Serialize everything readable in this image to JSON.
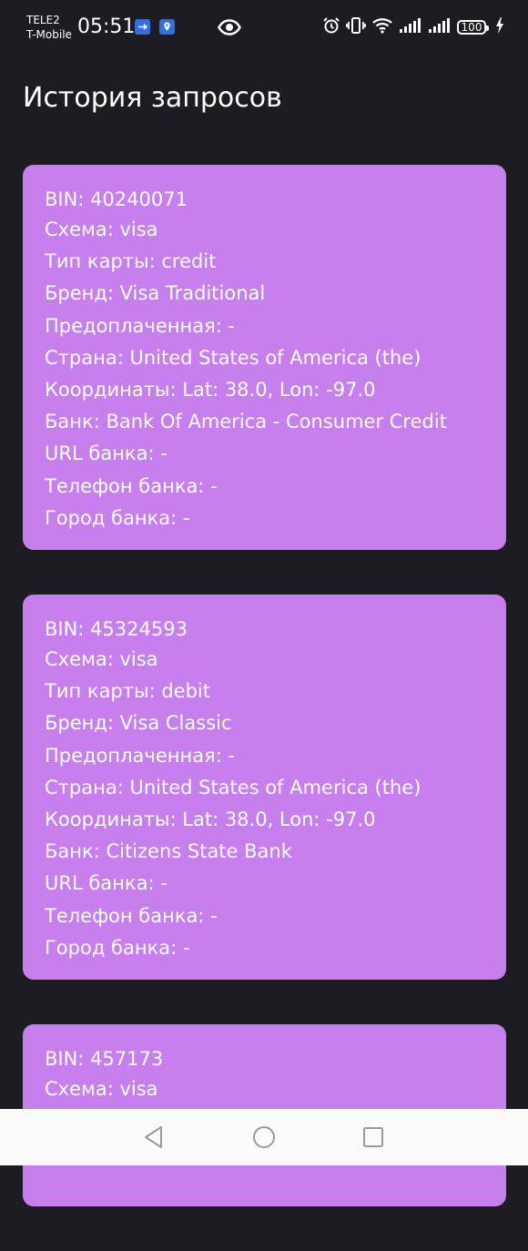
{
  "status_bar": {
    "carrier_1": "TELE2",
    "carrier_2": "T-Mobile",
    "time": "05:51",
    "battery": "100",
    "icons": [
      "usb-icon",
      "location-shield-icon",
      "eye-icon",
      "alarm-icon",
      "vibrate-icon",
      "wifi-icon",
      "signal-icon",
      "signal-icon",
      "battery-icon",
      "charging-icon"
    ]
  },
  "page": {
    "title": "История запросов"
  },
  "cards": [
    {
      "bin": "BIN: 40240071",
      "scheme": "Схема: visa",
      "type": "Тип карты: credit",
      "brand": "Бренд: Visa Traditional",
      "prepaid": "Предоплаченная: -",
      "country": "Страна: United States of America (the)",
      "coords": "Координаты: Lat: 38.0, Lon: -97.0",
      "bank": "Банк: Bank Of America - Consumer Credit",
      "bank_url": "URL банка: -",
      "bank_phone": "Телефон банка: -",
      "bank_city": "Город банка: -"
    },
    {
      "bin": "BIN: 45324593",
      "scheme": "Схема: visa",
      "type": "Тип карты: debit",
      "brand": "Бренд: Visa Classic",
      "prepaid": "Предоплаченная: -",
      "country": "Страна: United States of America (the)",
      "coords": "Координаты: Lat: 38.0, Lon: -97.0",
      "bank": "Банк: Citizens State Bank",
      "bank_url": "URL банка: -",
      "bank_phone": "Телефон банка: -",
      "bank_city": "Город банка: -"
    },
    {
      "bin": "BIN: 457173",
      "scheme": "Схема: visa"
    }
  ],
  "colors": {
    "background": "#1d1c22",
    "card": "#c77fee",
    "text": "#ffffff",
    "nav_bar": "#fafafa",
    "nav_icon": "#9a9a9a"
  }
}
